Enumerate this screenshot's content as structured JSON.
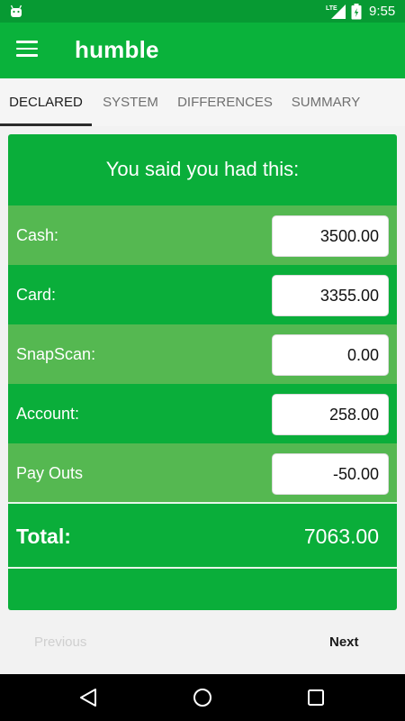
{
  "status_bar": {
    "time": "9:55",
    "network_label": "LTE",
    "icons": [
      "android-icon",
      "lte-signal-icon",
      "battery-icon"
    ]
  },
  "app_bar": {
    "title": "humble",
    "menu_icon": "hamburger-menu-icon"
  },
  "tabs": [
    {
      "label": "DECLARED",
      "active": true
    },
    {
      "label": "SYSTEM",
      "active": false
    },
    {
      "label": "DIFFERENCES",
      "active": false
    },
    {
      "label": "SUMMARY",
      "active": false
    }
  ],
  "card": {
    "title": "You said you had this:",
    "rows": [
      {
        "label": "Cash:",
        "value": "3500.00"
      },
      {
        "label": "Card:",
        "value": "3355.00"
      },
      {
        "label": "SnapScan:",
        "value": "0.00"
      },
      {
        "label": "Account:",
        "value": "258.00"
      },
      {
        "label": "Pay Outs",
        "value": "-50.00"
      }
    ],
    "total_label": "Total:",
    "total_value": "7063.00"
  },
  "footer": {
    "previous_label": "Previous",
    "next_label": "Next"
  },
  "nav_bar": {
    "icons": [
      "back-icon",
      "home-icon",
      "recents-icon"
    ]
  },
  "colors": {
    "status_bar": "#079a33",
    "app_bar": "#0ab23b",
    "card": "#0aae3a",
    "row_alt": "#55b851"
  }
}
